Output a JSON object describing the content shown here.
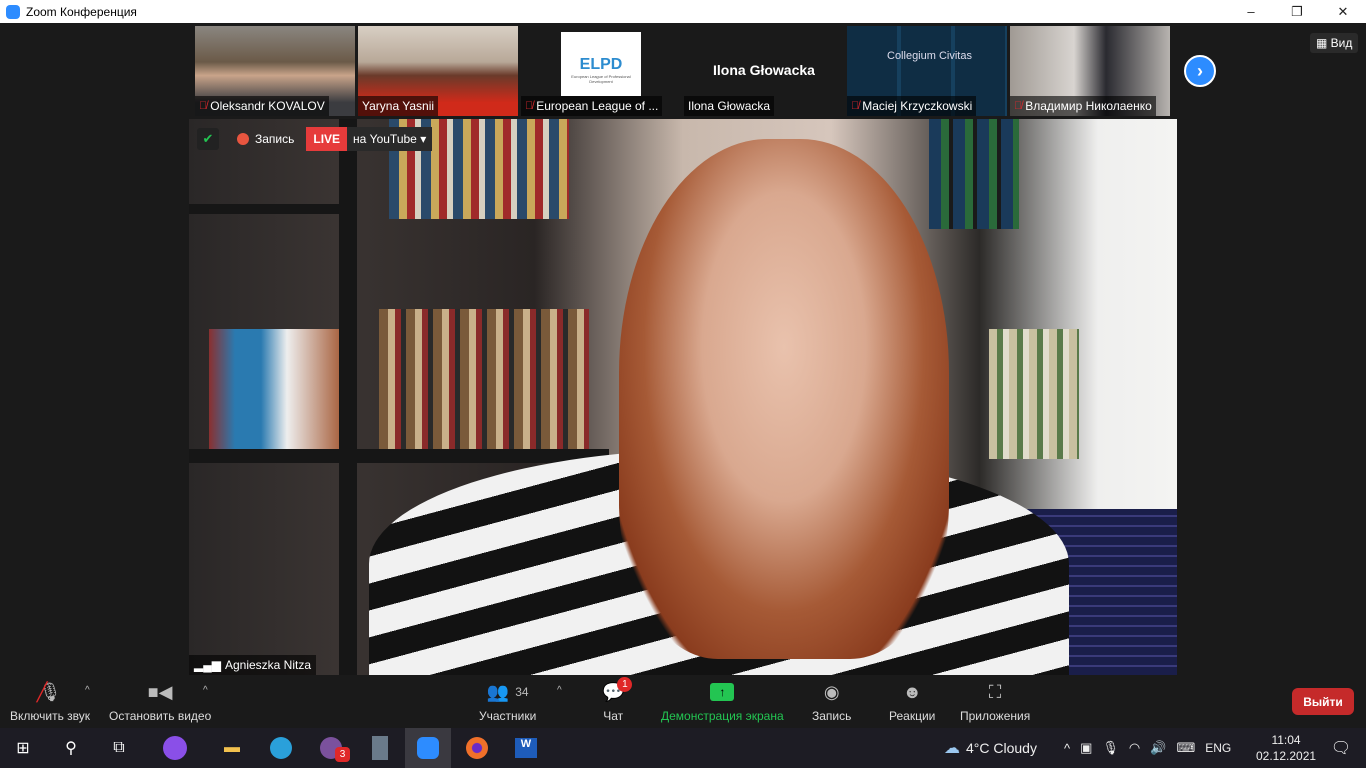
{
  "window": {
    "title": "Zoom Конференция",
    "minimize": "–",
    "maximize": "❐",
    "close": "✕"
  },
  "gallery": {
    "view_label": "Вид",
    "participants": [
      {
        "name": "Oleksandr KOVALOV",
        "muted": true
      },
      {
        "name": "Yaryna Yasnii",
        "muted": false
      },
      {
        "name": "European League of ...",
        "muted": true,
        "logo_text": "ELPD",
        "logo_sub": "European League of Professional Development"
      },
      {
        "name": "Ilona Głowacka",
        "muted": false,
        "display_name": "Ilona Głowacka"
      },
      {
        "name": "Maciej Krzyczkowski",
        "muted": true,
        "bg_text": "Collegium Civitas"
      },
      {
        "name": "Владимир Николаенко",
        "muted": true
      }
    ]
  },
  "main": {
    "recording_label": "Запись",
    "live_label": "LIVE",
    "stream_label": "на YouTube",
    "speaker_name": "Agnieszka Nitza"
  },
  "toolbar": {
    "unmute": "Включить звук",
    "stop_video": "Остановить видео",
    "participants": "Участники",
    "participants_count": "34",
    "chat": "Чат",
    "chat_badge": "1",
    "share": "Демонстрация экрана",
    "record": "Запись",
    "reactions": "Реакции",
    "apps": "Приложения",
    "leave": "Выйти"
  },
  "taskbar": {
    "viber_badge": "3",
    "weather": "4°C  Cloudy",
    "lang": "ENG",
    "time": "11:04",
    "date": "02.12.2021"
  },
  "colors": {
    "accent": "#2d8cff",
    "share": "#23c552",
    "leave": "#c52a2a",
    "live": "#e63b3b"
  }
}
